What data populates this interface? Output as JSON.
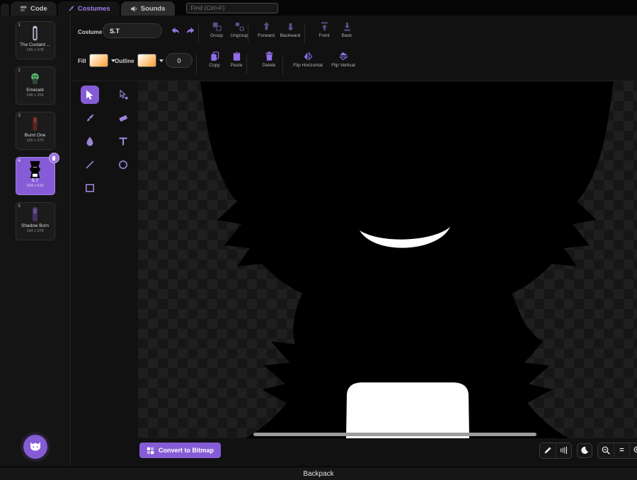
{
  "colors": {
    "accent": "#855cd6",
    "selected_costume": "#855cd6",
    "canvas_check_a": "#161616",
    "canvas_check_b": "#1f1f1f",
    "silhouette": "#000000"
  },
  "tabs": [
    {
      "label": "Code"
    },
    {
      "label": "Costumes"
    },
    {
      "label": "Sounds"
    }
  ],
  "find": {
    "placeholder": "Find (Ctrl+F)"
  },
  "costumes": [
    {
      "num": "1",
      "name": "The Custard ...",
      "size": "165 x 378"
    },
    {
      "num": "2",
      "name": "Emerald",
      "size": "248 x 256"
    },
    {
      "num": "3",
      "name": "Burnt One",
      "size": "165 x 379"
    },
    {
      "num": "4",
      "name": "S.T",
      "size": "224 x 515"
    },
    {
      "num": "5",
      "name": "Shadow Born",
      "size": "184 x 378"
    }
  ],
  "toolbar": {
    "costume_label": "Costume",
    "costume_name": "S.T",
    "group_label": "Group",
    "ungroup_label": "Ungroup",
    "forward_label": "Forward",
    "backward_label": "Backward",
    "front_label": "Front",
    "back_label": "Back",
    "fill_label": "Fill",
    "outline_label": "Outline",
    "outline_width": "0",
    "copy_label": "Copy",
    "paste_label": "Paste",
    "delete_label": "Delete",
    "flip_h_label": "Flip Horizontal",
    "flip_v_label": "Flip Vertical"
  },
  "canvas": {
    "convert_bitmap_label": "Convert to Bitmap",
    "zoom_reset_label": "="
  },
  "footer": {
    "backpack_label": "Backpack"
  }
}
